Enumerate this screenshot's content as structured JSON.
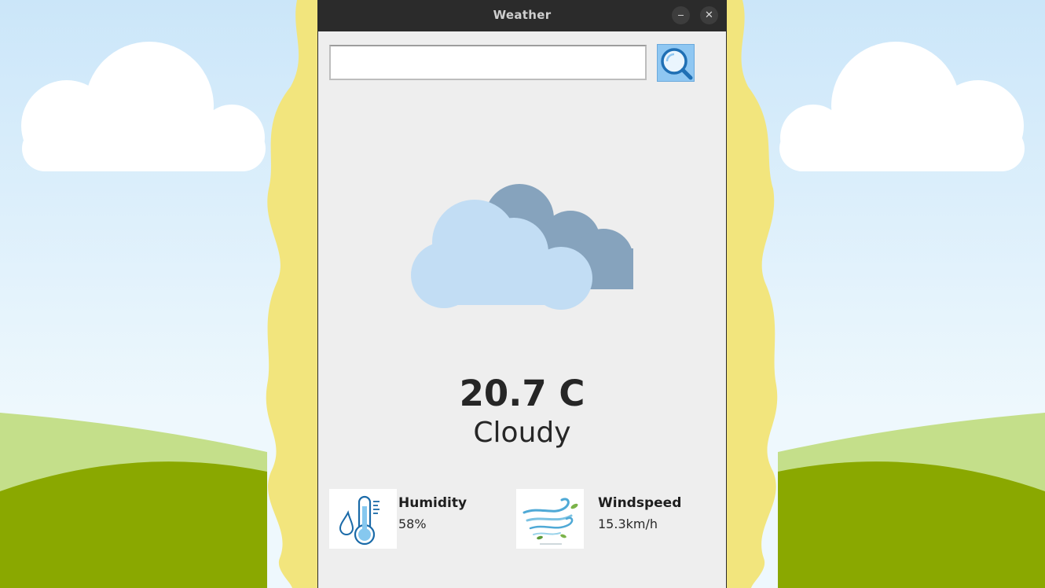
{
  "window": {
    "title": "Weather",
    "minimize_glyph": "‒",
    "close_glyph": "✕"
  },
  "search": {
    "value": "",
    "placeholder": "",
    "button_icon": "search-icon"
  },
  "weather": {
    "icon": "cloudy-icon",
    "temperature": "20.7 C",
    "description": "Cloudy"
  },
  "stats": {
    "humidity": {
      "label": "Humidity",
      "value": "58%",
      "icon": "thermometer-humidity-icon"
    },
    "windspeed": {
      "label": "Windspeed",
      "value": "15.3km/h",
      "icon": "wind-icon"
    }
  },
  "colors": {
    "sky_top": "#cfe8f9",
    "sky_bottom": "#eef8fd",
    "hill_light": "#c4df8a",
    "hill_dark": "#8aa800",
    "frame_yellow": "#f2e57d",
    "cloud_front": "#c2ddf4",
    "cloud_back": "#86a3bd",
    "search_button": "#8fc7f2"
  }
}
